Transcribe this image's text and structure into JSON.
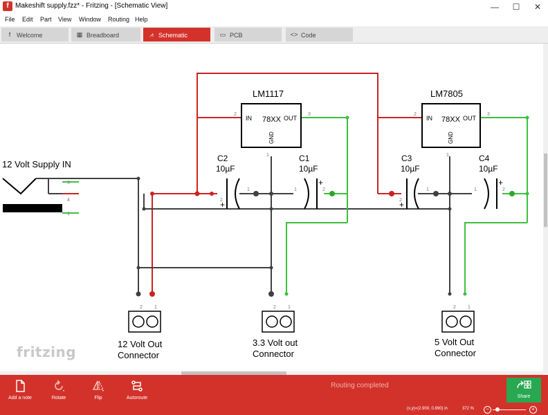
{
  "window": {
    "title": "Makeshift supply.fzz* - Fritzing - [Schematic View]",
    "app_icon_letter": "f",
    "minimize_glyph": "—",
    "maximize_glyph": "☐",
    "close_glyph": "✕"
  },
  "menu": [
    "File",
    "Edit",
    "Part",
    "View",
    "Window",
    "Routing",
    "Help"
  ],
  "tabs": [
    {
      "label": "Welcome",
      "icon": "fritzing-icon",
      "glyph": "f",
      "active": false
    },
    {
      "label": "Breadboard",
      "icon": "breadboard-icon",
      "glyph": "▦",
      "active": false
    },
    {
      "label": "Schematic",
      "icon": "resistor-icon",
      "glyph": "⩘",
      "active": true
    },
    {
      "label": "PCB",
      "icon": "pcb-icon",
      "glyph": "▭",
      "active": false
    },
    {
      "label": "Code",
      "icon": "code-icon",
      "glyph": "<>",
      "active": false
    }
  ],
  "schematic": {
    "supply_label": "12 Volt Supply IN",
    "jack_pins": [
      "3",
      "4",
      "1"
    ],
    "regulators": [
      {
        "name": "LM1117",
        "body": "78XX",
        "pin_in": "IN",
        "pin_out": "OUT",
        "pin_gnd": "GND",
        "num_in": "2",
        "num_out": "3",
        "num_gnd": "1"
      },
      {
        "name": "LM7805",
        "body": "78XX",
        "pin_in": "IN",
        "pin_out": "OUT",
        "pin_gnd": "GND",
        "num_in": "2",
        "num_out": "3",
        "num_gnd": "1"
      }
    ],
    "capacitors": [
      {
        "name": "C2",
        "value": "10µF",
        "pin_a": "2",
        "pin_b": "1"
      },
      {
        "name": "C1",
        "value": "10µF",
        "pin_a": "1",
        "pin_b": "2"
      },
      {
        "name": "C3",
        "value": "10µF",
        "pin_a": "2",
        "pin_b": "1"
      },
      {
        "name": "C4",
        "value": "10µF",
        "pin_a": "1",
        "pin_b": "2"
      }
    ],
    "polarity": "+",
    "connectors": [
      {
        "line1": "12 Volt Out",
        "line2": "Connector",
        "pin_a": "2",
        "pin_b": "1"
      },
      {
        "line1": "3.3 Volt out",
        "line2": "Connector",
        "pin_a": "2",
        "pin_b": "1"
      },
      {
        "line1": "5 Volt Out",
        "line2": "Connector",
        "pin_a": "2",
        "pin_b": "1"
      }
    ],
    "wire_colors": {
      "positive": "#cc2222",
      "ground": "#404040",
      "output": "#3cc03c"
    }
  },
  "watermark": "fritzing",
  "toolbar": {
    "add_note": "Add a note",
    "rotate": "Rotate",
    "flip": "Flip",
    "autoroute": "Autoroute",
    "share": "Share",
    "status": "Routing completed"
  },
  "statusbar": {
    "coords": "(x,y)=(2.900, 0.890) in",
    "zoom": "372 %",
    "zoom_minus": "−",
    "zoom_plus": "+"
  },
  "colors": {
    "accent": "#d3322a",
    "share": "#28a850"
  }
}
